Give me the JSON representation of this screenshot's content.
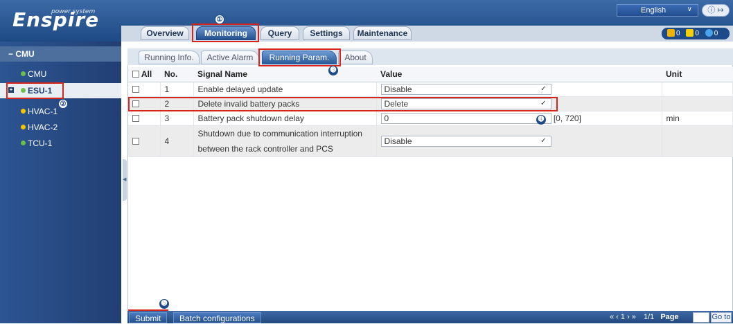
{
  "header": {
    "logo": "Enspire",
    "logo_sub": "power system",
    "language": "English",
    "top_icons": "ⓘ ↦",
    "tabs": [
      "Overview",
      "Monitoring",
      "Query",
      "Settings",
      "Maintenance"
    ],
    "active_tab": "Monitoring",
    "alarms": {
      "critical": "0",
      "major": "0",
      "minor": "0"
    }
  },
  "sidebar": {
    "root": "CMU",
    "items": [
      {
        "label": "CMU",
        "dot": "#6cc04a"
      },
      {
        "label": "ESU-1",
        "dot": "#6cc04a"
      },
      {
        "label": "HVAC-1",
        "dot": "#f5c400"
      },
      {
        "label": "HVAC-2",
        "dot": "#f5c400"
      },
      {
        "label": "TCU-1",
        "dot": "#6cc04a"
      }
    ]
  },
  "subtabs": [
    "Running Info.",
    "Active Alarm",
    "Running Param.",
    "About"
  ],
  "table": {
    "headers": {
      "all": "All",
      "no": "No.",
      "signal": "Signal Name",
      "value": "Value",
      "unit": "Unit"
    },
    "rows": [
      {
        "no": "1",
        "signal": "Enable delayed update",
        "value": "Disable",
        "range": "",
        "unit": ""
      },
      {
        "no": "2",
        "signal": "Delete invalid battery packs",
        "value": "Delete",
        "range": "",
        "unit": ""
      },
      {
        "no": "3",
        "signal": "Battery pack shutdown delay",
        "value": "0",
        "range": "[0, 720]",
        "unit": "min"
      },
      {
        "no": "4",
        "signal": "Shutdown due to communication interruption",
        "signal2": "between the rack controller and PCS",
        "value": "Disable",
        "range": "",
        "unit": ""
      }
    ]
  },
  "markers": [
    "①",
    "②",
    "➌",
    "➍",
    "➎"
  ],
  "footer": {
    "submit": "Submit",
    "batch": "Batch configurations",
    "pager_arrows": "« ‹ 1 › »",
    "page_count": "1/1",
    "page_label": "Page",
    "go": "Go to"
  }
}
